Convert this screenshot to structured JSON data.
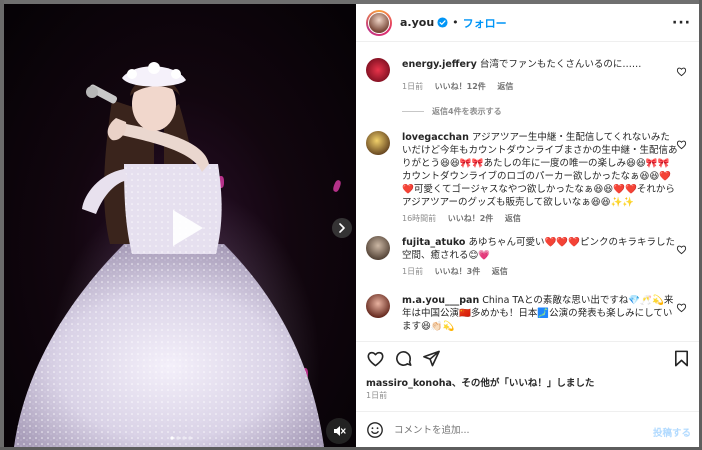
{
  "post": {
    "owner": "a.you",
    "separator": "•",
    "follow_label": "フォロー",
    "more_label": "···"
  },
  "comments": [
    {
      "user": "energy.jeffery",
      "text": "台湾でファンもたくさんいるのに……",
      "time": "1日前",
      "likes": "いいね！12件",
      "reply": "返信",
      "avatar_color": "#b0183a"
    },
    {
      "user": "lovegacchan",
      "text": "アジアツアー生中継・生配信してくれないみたいだけど今年もカウントダウンライブまさかの生中継・生配信ありがとう😆😆🎀🎀あたしの年に一度の唯一の楽しみ😆😆🎀🎀カウントダウンライブのロゴのパーカー欲しかったなぁ😆😆❤️❤️可愛くてゴージャスなやつ欲しかったなぁ😆😆❤️❤️それからアジアツアーのグッズも販売して欲しいなぁ😆😆✨✨",
      "time": "16時間前",
      "likes": "いいね！2件",
      "reply": "返信",
      "avatar_color": "#c9a23a"
    },
    {
      "user": "fujita_atuko",
      "text": "あゆちゃん可愛い❤️❤️❤️ピンクのキラキラした空間、癒される😊💗",
      "time": "1日前",
      "likes": "いいね！3件",
      "reply": "返信",
      "avatar_color": "#6b5a4a"
    },
    {
      "user": "m.a.you___pan",
      "text": "China TAとの素敵な思い出ですね💎🥂💫来年は中国公演🇨🇳多めかも！日本🗾公演の発表も楽しみにしています😆👏🏻💫",
      "avatar_color": "#8a3a2a"
    }
  ],
  "view_replies_label": "返信4件を表示する",
  "likes_summary": {
    "user": "massiro_konoha",
    "suffix": "、その他が「いいね！」しました"
  },
  "post_date": "1日前",
  "composer": {
    "placeholder": "コメントを追加...",
    "post_label": "投稿する"
  },
  "colors": {
    "accent": "#0095f6",
    "text": "#262626",
    "muted": "#8e8e8e"
  },
  "icons": [
    "verified-badge-icon",
    "heart-icon",
    "comment-icon",
    "share-icon",
    "bookmark-icon",
    "emoji-icon",
    "play-icon",
    "chevron-right-icon",
    "mute-icon",
    "more-icon"
  ]
}
